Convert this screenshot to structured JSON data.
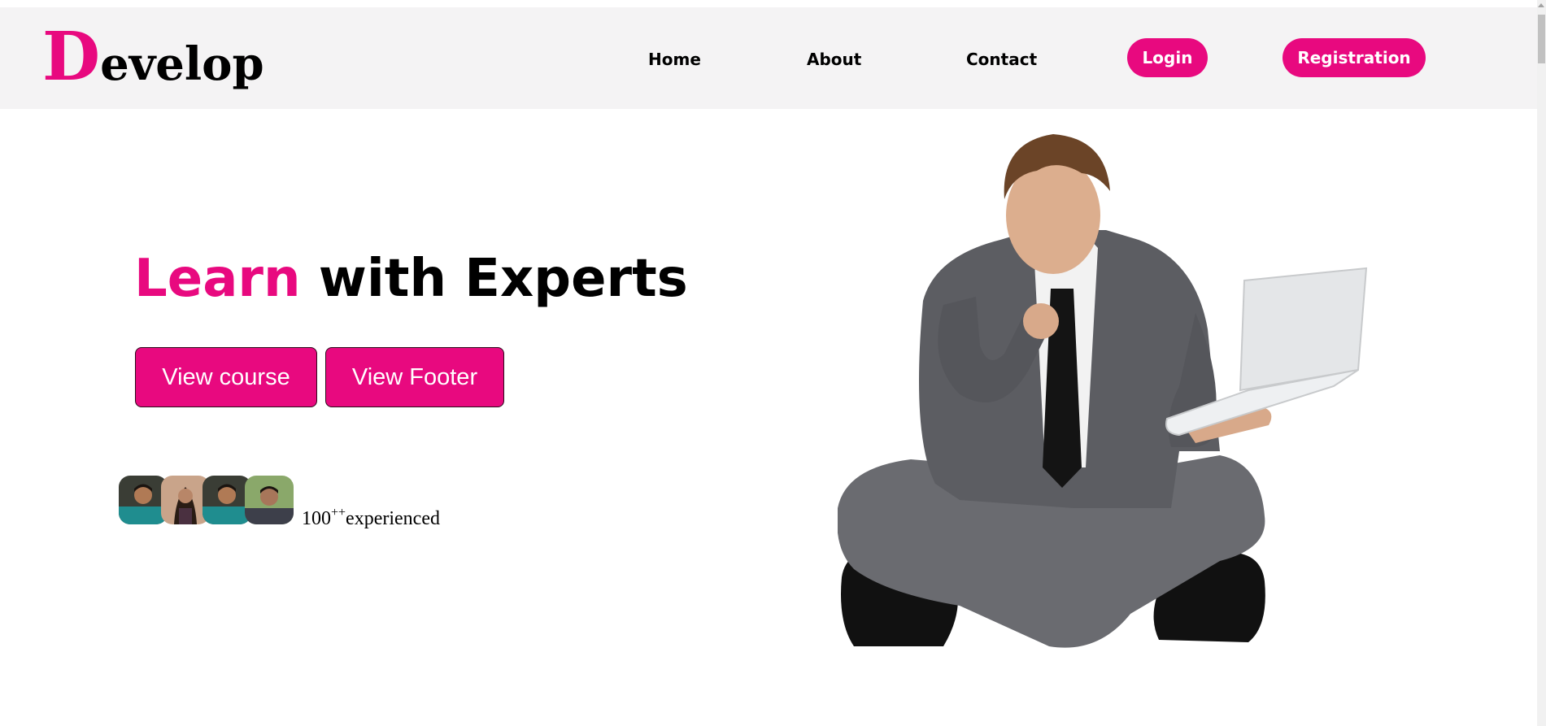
{
  "brand": {
    "first_letter": "D",
    "rest": "evelop"
  },
  "nav": {
    "home": "Home",
    "about": "About",
    "contact": "Contact",
    "login": "Login",
    "registration": "Registration"
  },
  "hero": {
    "title_highlight": "Learn",
    "title_rest": " with Experts",
    "buttons": {
      "view_course": "View course",
      "view_footer": "View Footer"
    },
    "stats": {
      "count": "100",
      "suffix": "++",
      "label": "experienced"
    }
  },
  "colors": {
    "accent": "#e8097f",
    "header_bg": "#f4f3f4"
  },
  "icons": [
    "avatar-1",
    "avatar-2",
    "avatar-3",
    "avatar-4"
  ]
}
